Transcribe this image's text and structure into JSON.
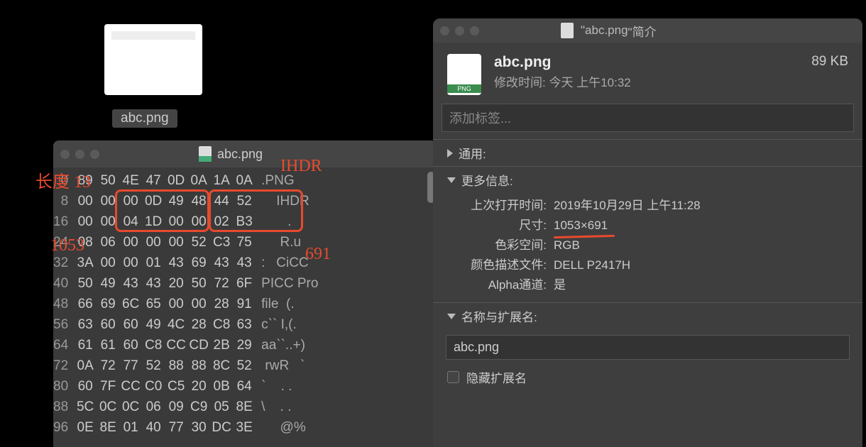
{
  "desktop_file": {
    "name": "abc.png"
  },
  "annotations": {
    "length_label": "长度 13",
    "ihdr_label": "IHDR",
    "width_val": "1053",
    "height_val": "691"
  },
  "hex": {
    "title": "abc.png",
    "offsets": [
      "0",
      "8",
      "16",
      "24",
      "32",
      "40",
      "48",
      "56",
      "64",
      "72",
      "80",
      "88",
      "96"
    ],
    "bytes": [
      [
        "89",
        "50",
        "4E",
        "47",
        "0D",
        "0A",
        "1A",
        "0A"
      ],
      [
        "00",
        "00",
        "00",
        "0D",
        "49",
        "48",
        "44",
        "52"
      ],
      [
        "00",
        "00",
        "04",
        "1D",
        "00",
        "00",
        "02",
        "B3"
      ],
      [
        "08",
        "06",
        "00",
        "00",
        "00",
        "52",
        "C3",
        "75"
      ],
      [
        "3A",
        "00",
        "00",
        "01",
        "43",
        "69",
        "43",
        "43"
      ],
      [
        "50",
        "49",
        "43",
        "43",
        "20",
        "50",
        "72",
        "6F"
      ],
      [
        "66",
        "69",
        "6C",
        "65",
        "00",
        "00",
        "28",
        "91"
      ],
      [
        "63",
        "60",
        "60",
        "49",
        "4C",
        "28",
        "C8",
        "63"
      ],
      [
        "61",
        "61",
        "60",
        "C8",
        "CC",
        "CD",
        "2B",
        "29"
      ],
      [
        "0A",
        "72",
        "77",
        "52",
        "88",
        "88",
        "8C",
        "52"
      ],
      [
        "60",
        "7F",
        "CC",
        "C0",
        "C5",
        "20",
        "0B",
        "64"
      ],
      [
        "5C",
        "0C",
        "0C",
        "06",
        "09",
        "C9",
        "05",
        "8E"
      ],
      [
        "0E",
        "8E",
        "01",
        "40",
        "77",
        "30",
        "DC",
        "3E"
      ]
    ],
    "ascii": [
      ".PNG    ",
      "    IHDR",
      "       .",
      "     R.u",
      ":   CiCC",
      "PICC Pro",
      "file  (.",
      "c`` I,(.",
      "aa``..+)",
      " rwR   `",
      "`    . .",
      "\\    . .",
      "     @% "
    ]
  },
  "info": {
    "title_prefix": "\"",
    "title_name": "abc.png",
    "title_suffix": "\"简介",
    "filename": "abc.png",
    "size": "89 KB",
    "modified_label": "修改时间:",
    "modified_value": "今天 上午10:32",
    "tags_placeholder": "添加标签...",
    "section_general": "通用:",
    "section_more": "更多信息:",
    "props": {
      "last_open_k": "上次打开时间:",
      "last_open_v": "2019年10月29日 上午11:28",
      "dimensions_k": "尺寸:",
      "dimensions_v": "1053×691",
      "colorspace_k": "色彩空间:",
      "colorspace_v": "RGB",
      "profile_k": "颜色描述文件:",
      "profile_v": "DELL P2417H",
      "alpha_k": "Alpha通道:",
      "alpha_v": "是"
    },
    "section_name": "名称与扩展名:",
    "name_value": "abc.png",
    "hide_ext": "隐藏扩展名"
  }
}
